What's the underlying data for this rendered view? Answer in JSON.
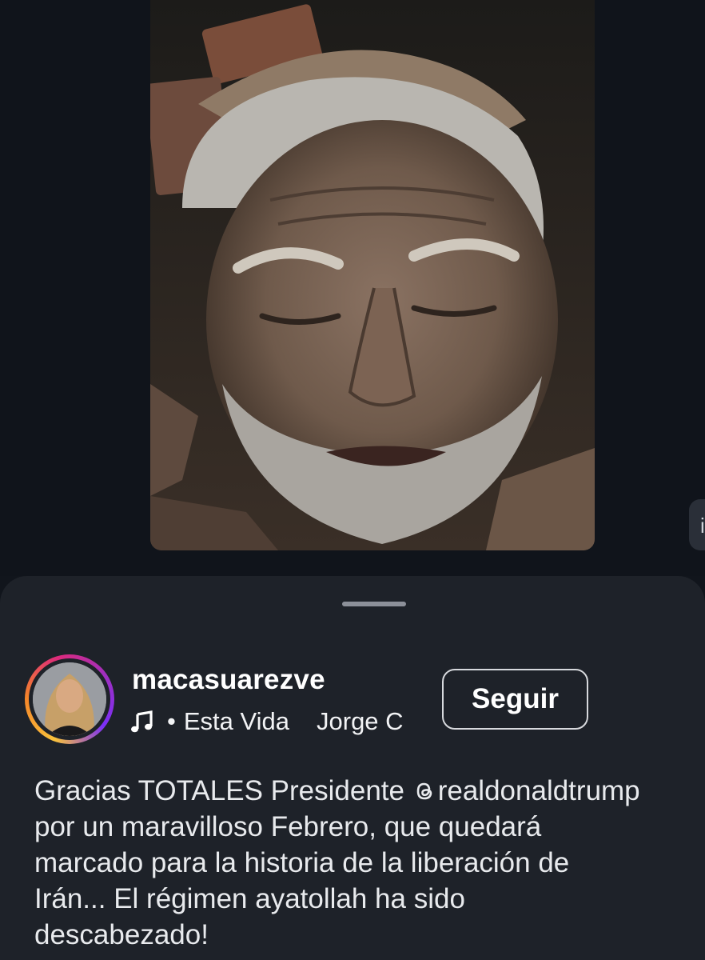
{
  "post": {
    "media": {
      "description": "photo",
      "next_icon": "info-icon",
      "next_glyph": "i"
    },
    "author": {
      "username": "macasuarezve",
      "avatar_icon": "avatar"
    },
    "audio": {
      "icon": "music-note-icon",
      "separator": "•",
      "song": "Esta Vida",
      "artist": "Jorge C"
    },
    "follow_label": "Seguir",
    "caption": {
      "line1_prefix": "Gracias TOTALES Presidente ",
      "mention_icon": "threads-icon",
      "mention": "realdonaldtrump",
      "line2": "por un maravilloso Febrero, que quedará",
      "line3": "marcado para la historia de la liberación de",
      "line4": "Irán... El régimen ayatollah ha sido",
      "line5": "descabezado!"
    }
  },
  "colors": {
    "background": "#11151c",
    "sheet": "#1e2229",
    "ring_start": "#f9c23c",
    "ring_mid": "#dd2a7b",
    "ring_end": "#7b2ff7",
    "text": "#ffffff"
  }
}
